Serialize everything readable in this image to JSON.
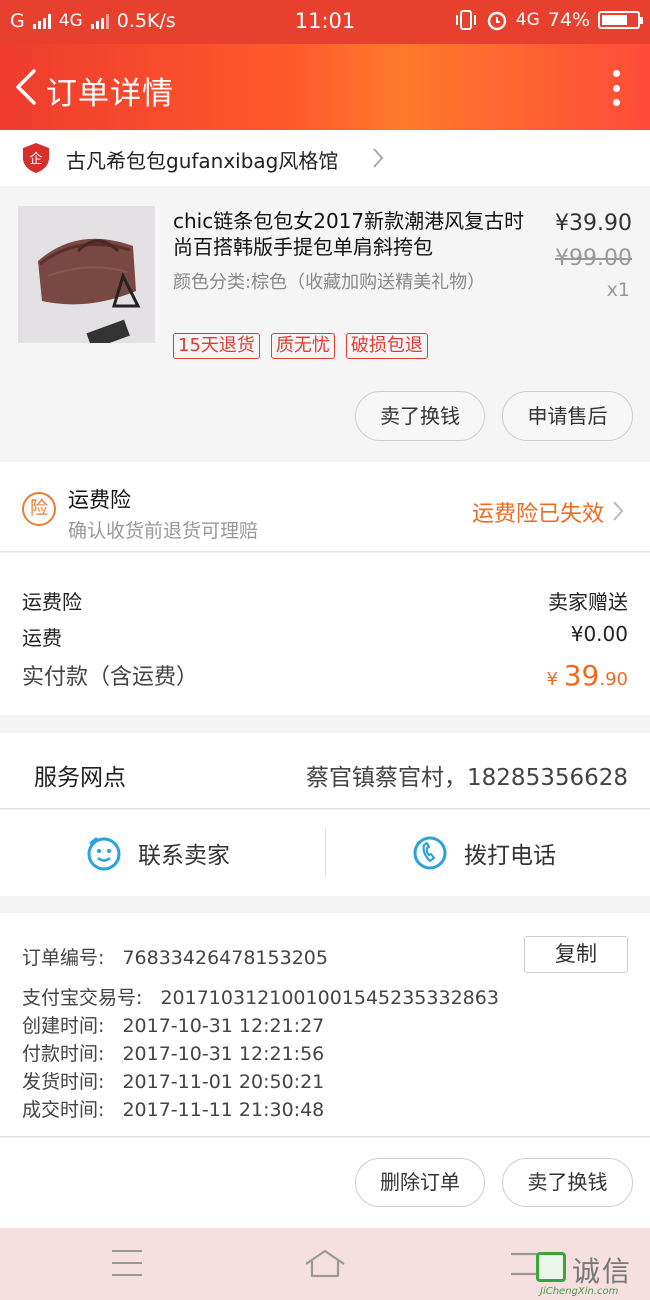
{
  "status_bar": {
    "carrier1": "G",
    "network": "4G",
    "speed": "0.5K/s",
    "time": "11:01",
    "net_right": "4G",
    "battery_text": "74%",
    "battery_level": 0.74
  },
  "header": {
    "title": "订单详情"
  },
  "store": {
    "name": "古凡希包包gufanxibag风格馆"
  },
  "product": {
    "name": "chic链条包包女2017新款潮港风复古时尚百搭韩版手提包单肩斜挎包",
    "sku": "颜色分类:棕色（收藏加购送精美礼物）",
    "price": "¥39.90",
    "original_price": "¥99.00",
    "quantity": "x1",
    "tags": [
      "15天退货",
      "质无忧",
      "破损包退"
    ],
    "button_sell": "卖了换钱",
    "button_aftersale": "申请售后"
  },
  "insurance": {
    "icon_char": "险",
    "title": "运费险",
    "subtitle": "确认收货前退货可理赔",
    "status": "运费险已失效"
  },
  "costs": {
    "insurance_label": "运费险",
    "insurance_value": "卖家赠送",
    "shipping_label": "运费",
    "shipping_value": "¥0.00",
    "paid_label": "实付款（含运费）",
    "paid_currency": "¥",
    "paid_int": "39",
    "paid_dec": ".90"
  },
  "service": {
    "label": "服务网点",
    "value": "蔡官镇蔡官村，18285356628"
  },
  "contact": {
    "seller_label": "联系卖家",
    "call_label": "拨打电话"
  },
  "order_info": {
    "order_no_label": "订单编号:",
    "order_no": "76833426478153205",
    "copy_label": "复制",
    "alipay_label": "支付宝交易号:",
    "alipay_no": "2017103121001001545235332863",
    "created_label": "创建时间:",
    "created": "2017-10-31 12:21:27",
    "paid_label": "付款时间:",
    "paid": "2017-10-31 12:21:56",
    "shipped_label": "发货时间:",
    "shipped": "2017-11-01 20:50:21",
    "done_label": "成交时间:",
    "done": "2017-11-11 21:30:48"
  },
  "actions": {
    "delete": "删除订单",
    "sell": "卖了换钱"
  },
  "watermark": {
    "text": "诚信",
    "url": "JiChengXin.com"
  },
  "colors": {
    "accent": "#f06a1e",
    "header_red": "#ef3b2d",
    "tag_red": "#e03c32"
  }
}
